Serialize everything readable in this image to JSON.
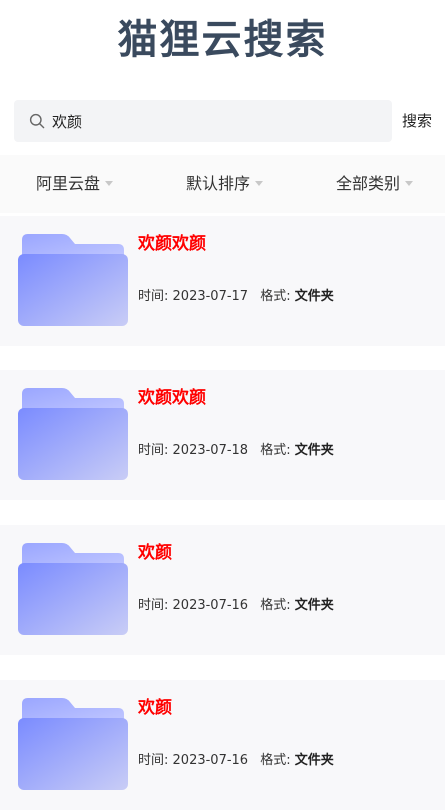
{
  "title": "猫狸云搜索",
  "search": {
    "query": "欢颜",
    "button_label": "搜索"
  },
  "filters": [
    {
      "label": "阿里云盘"
    },
    {
      "label": "默认排序"
    },
    {
      "label": "全部类别"
    }
  ],
  "results": [
    {
      "name": "欢颜欢颜",
      "time_label": "时间:",
      "date": "2023-07-17",
      "format_label": "格式:",
      "format": "文件夹"
    },
    {
      "name": "欢颜欢颜",
      "time_label": "时间:",
      "date": "2023-07-18",
      "format_label": "格式:",
      "format": "文件夹"
    },
    {
      "name": "欢颜",
      "time_label": "时间:",
      "date": "2023-07-16",
      "format_label": "格式:",
      "format": "文件夹"
    },
    {
      "name": "欢颜",
      "time_label": "时间:",
      "date": "2023-07-16",
      "format_label": "格式:",
      "format": "文件夹"
    }
  ],
  "colors": {
    "title": "#3a4a5e",
    "result_name": "#ff0000",
    "folder_light": "#a9b4ff",
    "folder_dark": "#7b8cff"
  },
  "icons": {
    "search": "search-icon",
    "dropdown": "caret-down-icon",
    "folder": "folder-icon"
  }
}
